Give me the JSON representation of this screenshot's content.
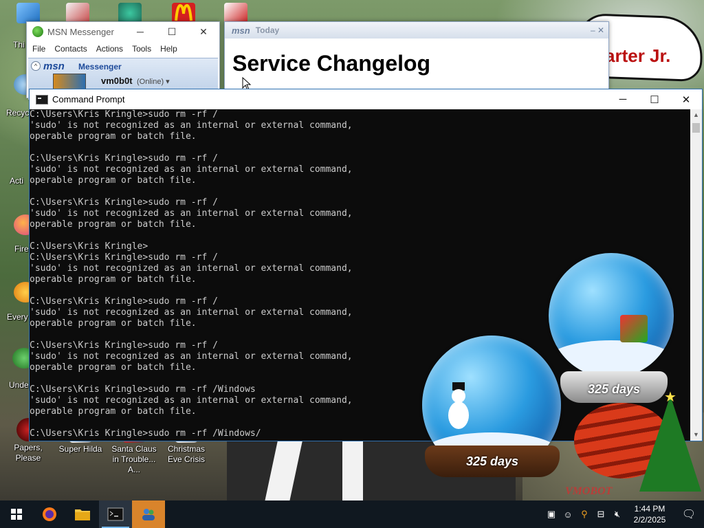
{
  "desktop": {
    "icons_left_partial": [
      "Thi",
      "Recyc",
      "Acti",
      "Fire",
      "Every",
      "Unde"
    ],
    "bottom_icons": [
      "Papers, Please",
      "Super Hilda",
      "Santa Claus in Trouble... A...",
      "Christmas Eve Crisis"
    ],
    "banner_text": "arter Jr."
  },
  "msn": {
    "title": "MSN Messenger",
    "menu": [
      "File",
      "Contacts",
      "Actions",
      "Tools",
      "Help"
    ],
    "brand": "msn",
    "brand_word": "Messenger",
    "username": "vm0b0t",
    "status": "(Online) ▾"
  },
  "today": {
    "logo": "msn",
    "label": "Today",
    "heading": "Service Changelog"
  },
  "cmd": {
    "title": "Command Prompt",
    "lines": [
      "C:\\Users\\Kris Kringle>sudo rm -rf /",
      "'sudo' is not recognized as an internal or external command,",
      "operable program or batch file.",
      "",
      "C:\\Users\\Kris Kringle>sudo rm -rf /",
      "'sudo' is not recognized as an internal or external command,",
      "operable program or batch file.",
      "",
      "C:\\Users\\Kris Kringle>sudo rm -rf /",
      "'sudo' is not recognized as an internal or external command,",
      "operable program or batch file.",
      "",
      "C:\\Users\\Kris Kringle>",
      "C:\\Users\\Kris Kringle>sudo rm -rf /",
      "'sudo' is not recognized as an internal or external command,",
      "operable program or batch file.",
      "",
      "C:\\Users\\Kris Kringle>sudo rm -rf /",
      "'sudo' is not recognized as an internal or external command,",
      "operable program or batch file.",
      "",
      "C:\\Users\\Kris Kringle>sudo rm -rf /",
      "'sudo' is not recognized as an internal or external command,",
      "operable program or batch file.",
      "",
      "C:\\Users\\Kris Kringle>sudo rm -rf /Windows",
      "'sudo' is not recognized as an internal or external command,",
      "operable program or batch file.",
      "",
      "C:\\Users\\Kris Kringle>sudo rm -rf /Windows/"
    ]
  },
  "widgets": {
    "globe_small_days": "325 days",
    "globe_large_days": "325 days",
    "watermark": "VMOBOT"
  },
  "taskbar": {
    "apps": [
      "start-button",
      "firefox",
      "file-explorer",
      "command-prompt",
      "people-app"
    ],
    "clock_time": "1:44 PM",
    "clock_date": "2/2/2025"
  },
  "colors": {
    "cmd_bg": "#0c0c0c",
    "cmd_text": "#cccccc",
    "taskbar": "#101820",
    "msn_brand": "#1d4a9a"
  }
}
